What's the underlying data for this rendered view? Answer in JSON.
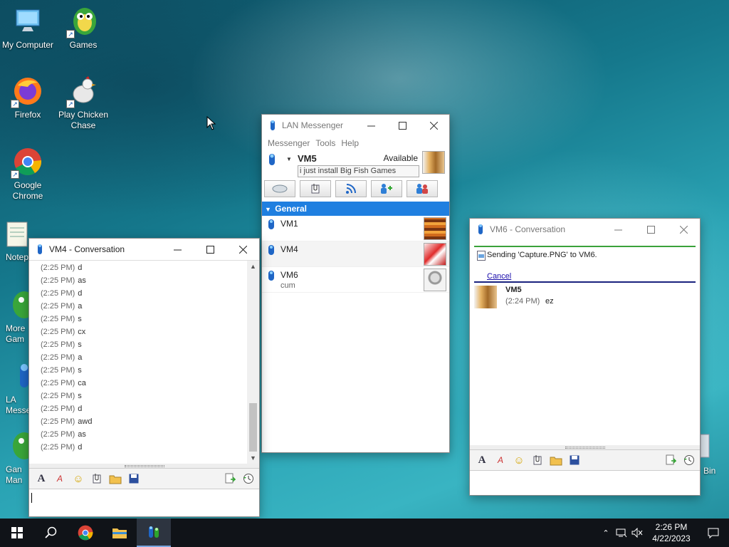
{
  "desktop": {
    "icons": [
      {
        "label": "My Computer",
        "icon": "computer-icon"
      },
      {
        "label": "Games",
        "icon": "fish-icon"
      },
      {
        "label": "Firefox",
        "icon": "firefox-icon"
      },
      {
        "label": "Play Chicken Chase",
        "icon": "chicken-icon"
      },
      {
        "label": "Google Chrome",
        "icon": "chrome-icon"
      },
      {
        "label": "Notep",
        "icon": "notepad-icon"
      },
      {
        "label": "More Gam",
        "icon": "fish-icon"
      },
      {
        "label": "LA Messe",
        "icon": "lan-messenger-icon"
      },
      {
        "label": "Gan Man",
        "icon": "fish-icon"
      },
      {
        "label": "Bin",
        "icon": "recycle-bin-icon"
      }
    ]
  },
  "lan_messenger": {
    "title": "LAN Messenger",
    "menu": [
      "Messenger",
      "Tools",
      "Help"
    ],
    "user": {
      "name": "VM5",
      "status": "Available",
      "note": "i just install Big Fish Games"
    },
    "group": "General",
    "contacts": [
      {
        "name": "VM1",
        "status": ""
      },
      {
        "name": "VM4",
        "status": ""
      },
      {
        "name": "VM6",
        "status": "cum"
      }
    ]
  },
  "vm4_conversation": {
    "title": "VM4 - Conversation",
    "messages": [
      {
        "time": "(2:25 PM)",
        "text": "d"
      },
      {
        "time": "(2:25 PM)",
        "text": "as"
      },
      {
        "time": "(2:25 PM)",
        "text": "d"
      },
      {
        "time": "(2:25 PM)",
        "text": "a"
      },
      {
        "time": "(2:25 PM)",
        "text": "s"
      },
      {
        "time": "(2:25 PM)",
        "text": "cx"
      },
      {
        "time": "(2:25 PM)",
        "text": "s"
      },
      {
        "time": "(2:25 PM)",
        "text": "a"
      },
      {
        "time": "(2:25 PM)",
        "text": "s"
      },
      {
        "time": "(2:25 PM)",
        "text": "ca"
      },
      {
        "time": "(2:25 PM)",
        "text": "s"
      },
      {
        "time": "(2:25 PM)",
        "text": "d"
      },
      {
        "time": "(2:25 PM)",
        "text": "awd"
      },
      {
        "time": "(2:25 PM)",
        "text": "as"
      },
      {
        "time": "(2:25 PM)",
        "text": "d"
      }
    ]
  },
  "vm6_conversation": {
    "title": "VM6 - Conversation",
    "transfer": {
      "text": "Sending 'Capture.PNG' to VM6.",
      "cancel_label": "Cancel"
    },
    "message": {
      "sender": "VM5",
      "time": "(2:24 PM)",
      "text": "ez"
    }
  },
  "taskbar": {
    "clock_time": "2:26 PM",
    "clock_date": "4/22/2023"
  },
  "colors": {
    "group_header": "#1f7fe0",
    "link": "#1a0dab"
  }
}
